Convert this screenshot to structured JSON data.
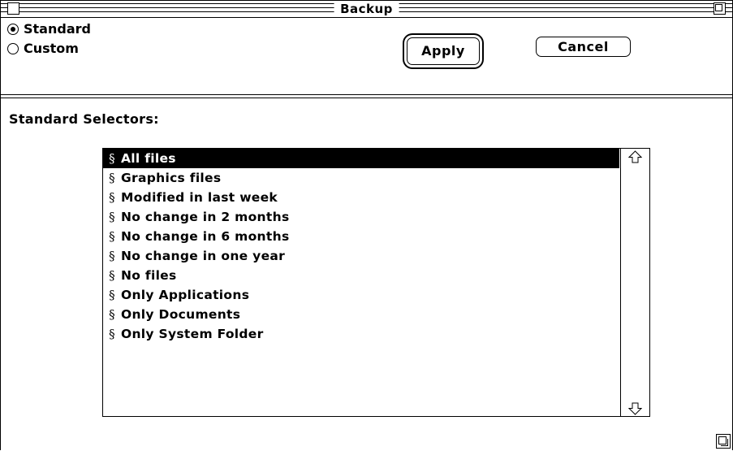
{
  "window": {
    "title": "Backup"
  },
  "options": {
    "standard_label": "Standard",
    "custom_label": "Custom",
    "selected": "standard"
  },
  "buttons": {
    "apply_label": "Apply",
    "cancel_label": "Cancel"
  },
  "selectors": {
    "heading": "Standard Selectors:",
    "marker": "§",
    "selected_index": 0,
    "items": [
      "All files",
      "Graphics files",
      "Modified in last week",
      "No change in 2 months",
      "No change in 6 months",
      "No change in one year",
      "No files",
      "Only Applications",
      "Only Documents",
      "Only System Folder"
    ]
  },
  "icons": {
    "close": "close-box-icon",
    "zoom": "zoom-box-icon",
    "scroll_up": "up-arrow-icon",
    "scroll_down": "down-arrow-icon",
    "grow": "grow-box-icon"
  }
}
